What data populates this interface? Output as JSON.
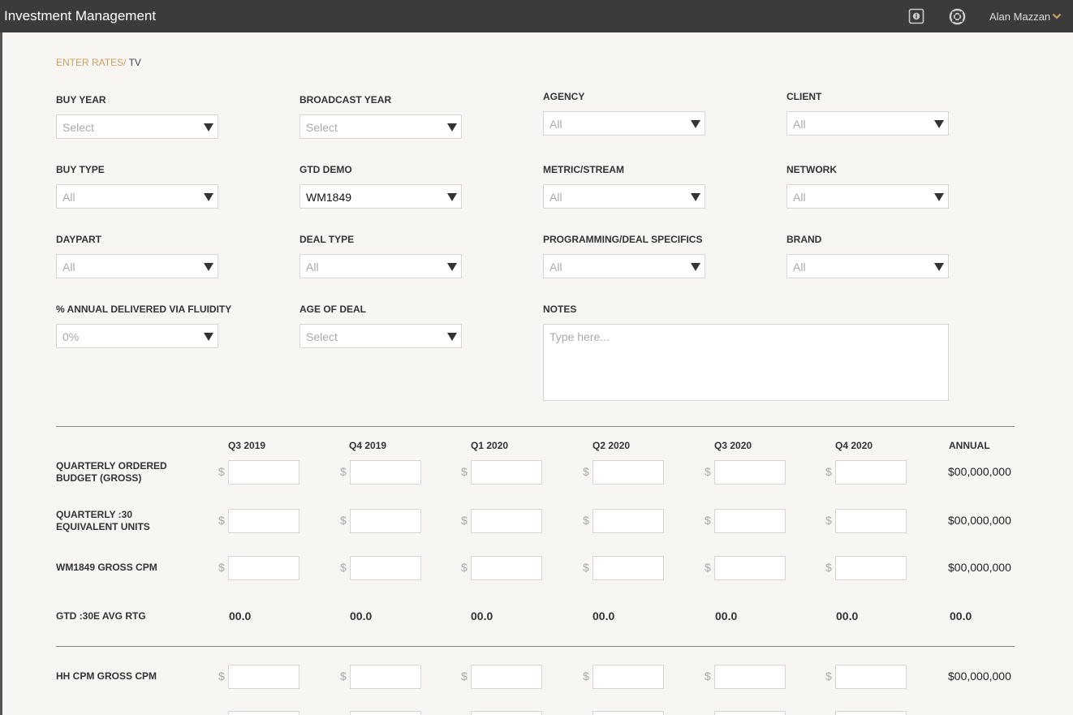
{
  "header": {
    "title": "Investment Management",
    "user_name": "Alan Mazzan",
    "icons": [
      "info-icon",
      "help-lifebuoy-icon",
      "chevron-down-icon"
    ],
    "accent": "#c8a060",
    "bar_color": "#3b3b3b"
  },
  "breadcrumb": {
    "section": "ENTER RATES/",
    "current": "TV"
  },
  "filters": {
    "buy_year": {
      "label": "BUY YEAR",
      "value": "Select"
    },
    "broadcast_year": {
      "label": "BROADCAST YEAR",
      "value": "Select"
    },
    "agency": {
      "label": "AGENCY",
      "value": "All"
    },
    "client": {
      "label": "CLIENT",
      "value": "All"
    },
    "buy_type": {
      "label": "BUY TYPE",
      "value": "All"
    },
    "gtd_demo": {
      "label": "GTD DEMO",
      "value": "WM1849"
    },
    "metric_stream": {
      "label": "METRIC/STREAM",
      "value": "All"
    },
    "network": {
      "label": "NETWORK",
      "value": "All"
    },
    "daypart": {
      "label": "DAYPART",
      "value": "All"
    },
    "deal_type": {
      "label": "DEAL TYPE",
      "value": "All"
    },
    "programming": {
      "label": "PROGRAMMING/DEAL SPECIFICS",
      "value": "All"
    },
    "brand": {
      "label": "BRAND",
      "value": "All"
    },
    "fluidity": {
      "label": "% ANNUAL DELIVERED VIA FLUIDITY",
      "value": "0%"
    },
    "age_of_deal": {
      "label": "AGE OF DEAL",
      "value": "Select"
    },
    "notes": {
      "label": "NOTES",
      "placeholder": "Type here..."
    }
  },
  "grid": {
    "columns": [
      "Q3 2019",
      "Q4 2019",
      "Q1 2020",
      "Q2 2020",
      "Q3 2020",
      "Q4 2020"
    ],
    "annual_label": "ANNUAL",
    "currency_symbol": "$",
    "rows": {
      "ordered_budget": {
        "label_line1": "QUARTERLY ORDERED",
        "label_line2": "BUDGET (GROSS)",
        "annual": "$00,000,000"
      },
      "equiv_units": {
        "label_line1": "QUARTERLY :30",
        "label_line2": "EQUIVALENT UNITS",
        "annual": "$00,000,000"
      },
      "gross_cpm": {
        "label": "WM1849 GROSS CPM",
        "annual": "$00,000,000"
      },
      "avg_rtg": {
        "label": "GTD :30E AVG RTG",
        "values": [
          "00.0",
          "00.0",
          "00.0",
          "00.0",
          "00.0",
          "00.0"
        ],
        "annual": "00.0"
      },
      "hh_cpm": {
        "label": "HH CPM GROSS CPM",
        "annual": "$00,000,000"
      }
    }
  }
}
